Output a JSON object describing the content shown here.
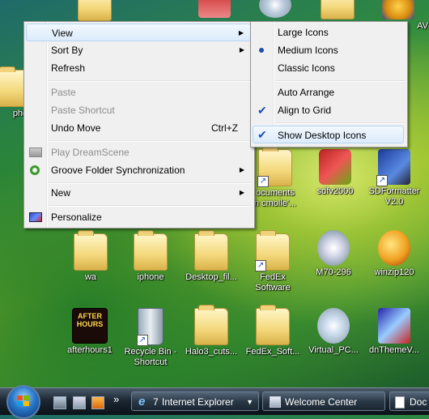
{
  "context_menu": {
    "items": [
      {
        "label": "View",
        "submenu": true
      },
      {
        "label": "Sort By",
        "submenu": true
      },
      {
        "label": "Refresh"
      },
      {
        "label": "Paste",
        "disabled": true
      },
      {
        "label": "Paste Shortcut",
        "disabled": true
      },
      {
        "label": "Undo Move",
        "shortcut": "Ctrl+Z"
      },
      {
        "label": "Play DreamScene",
        "disabled": true
      },
      {
        "label": "Groove Folder Synchronization",
        "submenu": true
      },
      {
        "label": "New",
        "submenu": true
      },
      {
        "label": "Personalize"
      }
    ]
  },
  "view_submenu": {
    "items": [
      {
        "label": "Large Icons"
      },
      {
        "label": "Medium Icons",
        "selected": true
      },
      {
        "label": "Classic Icons"
      },
      {
        "label": "Auto Arrange"
      },
      {
        "label": "Align to Grid",
        "checked": true
      },
      {
        "label": "Show Desktop Icons",
        "checked": true
      }
    ]
  },
  "desktop_icons": [
    {
      "label": "pho",
      "type": "folder"
    },
    {
      "label": "ocuments\nn cmolle'...",
      "type": "folder"
    },
    {
      "label": "sdfv2000",
      "type": "app"
    },
    {
      "label": "SDFormatter\nV2.0",
      "type": "app"
    },
    {
      "label": "AV",
      "type": "app"
    },
    {
      "label": "wa",
      "type": "folder"
    },
    {
      "label": "iphone",
      "type": "folder"
    },
    {
      "label": "Desktop_fil...",
      "type": "folder"
    },
    {
      "label": "FedEx\nSoftware",
      "type": "folder"
    },
    {
      "label": "M70-296",
      "type": "app"
    },
    {
      "label": "winzip120",
      "type": "app"
    },
    {
      "label": "afterhours1",
      "type": "app"
    },
    {
      "label": "Recycle Bin -\nShortcut",
      "type": "recycle"
    },
    {
      "label": "Halo3_cuts...",
      "type": "folder"
    },
    {
      "label": "FedEx_Soft...",
      "type": "folder"
    },
    {
      "label": "Virtual_PC...",
      "type": "app"
    },
    {
      "label": "dnThemeV...",
      "type": "app"
    }
  ],
  "afterhours_art_text": "AFTER\nHOURS",
  "taskbar": {
    "buttons": [
      {
        "label": "Internet Explorer",
        "count": "7"
      },
      {
        "label": "Welcome Center"
      },
      {
        "label": "Doc"
      }
    ],
    "overflow": "»"
  },
  "colors": {
    "menu_bg": "#f0f0f0",
    "menu_highlight": "#dcebfc",
    "disabled_text": "#8d8d8d"
  }
}
